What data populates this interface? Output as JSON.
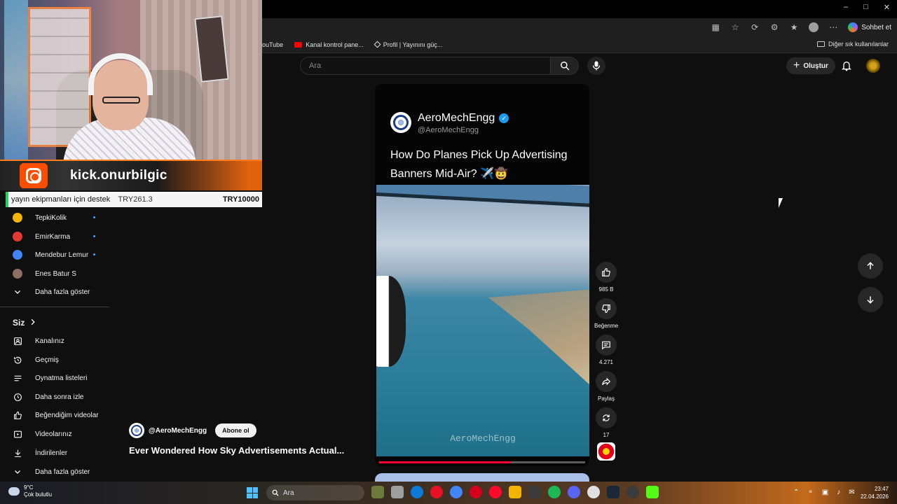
{
  "browser": {
    "copilot_label": "Sohbet et",
    "bookmarks": [
      {
        "label": "ouTube"
      },
      {
        "label": "Kanal kontrol pane..."
      },
      {
        "label": "Profil | Yayınını güç..."
      }
    ],
    "other_bookmarks": "Diğer sık kullanılanlar"
  },
  "header": {
    "search_placeholder": "Ara",
    "create_label": "Oluştur"
  },
  "overlay": {
    "instagram_handle": "kick.onurbilgic",
    "goal_label": "yayın ekipmanları için destek",
    "goal_current": "TRY261.3",
    "goal_target": "TRY10000"
  },
  "sidebar": {
    "subscriptions": [
      {
        "name": "TepkiKolik",
        "color": "#f4b400",
        "live": true
      },
      {
        "name": "EmirKarma",
        "color": "#e53935",
        "live": true
      },
      {
        "name": "Mendebur Lemur",
        "color": "#4285f4",
        "live": true
      },
      {
        "name": "Enes Batur S",
        "color": "#8d6e63",
        "live": false
      }
    ],
    "show_more_1": "Daha fazla göster",
    "you_header": "Siz",
    "you_items": [
      {
        "label": "Kanalınız",
        "icon": "channel-icon"
      },
      {
        "label": "Geçmiş",
        "icon": "history-icon"
      },
      {
        "label": "Oynatma listeleri",
        "icon": "playlist-icon"
      },
      {
        "label": "Daha sonra izle",
        "icon": "clock-icon"
      },
      {
        "label": "Beğendiğim videolar",
        "icon": "like-icon"
      },
      {
        "label": "Videolarınız",
        "icon": "video-icon"
      },
      {
        "label": "İndirilenler",
        "icon": "download-icon"
      }
    ],
    "show_more_2": "Daha fazla göster"
  },
  "short": {
    "card_name": "AeroMechEngg",
    "card_handle": "@AeroMechEngg",
    "card_title": "How Do Planes Pick Up Advertising Banners Mid-Air? ✈️🤠",
    "watermark": "AeroMechEngg",
    "progress_fraction": 0.64,
    "channel_handle": "@AeroMechEngg",
    "subscribe_label": "Abone ol",
    "title": "Ever Wondered How Sky Advertisements Actual..."
  },
  "actions": {
    "likes": "985 B",
    "dislike_label": "Beğenme",
    "comments": "4.271",
    "share_label": "Paylaş",
    "remix_count": "17"
  },
  "taskbar": {
    "temperature": "9°C",
    "weather": "Çok bulutlu",
    "search_label": "Ara",
    "time": "23:47",
    "date": "22.04.2026"
  },
  "colors": {
    "accent_red": "#ff0033",
    "link_blue": "#3ea6ff"
  }
}
